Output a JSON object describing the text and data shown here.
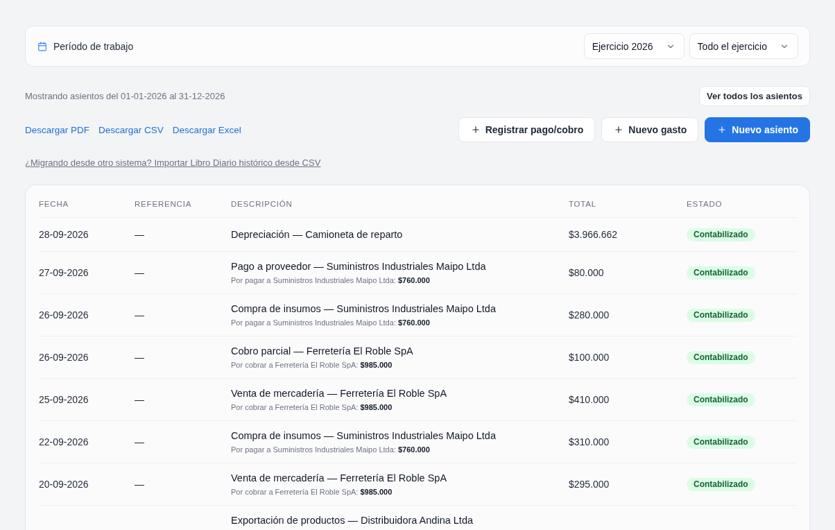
{
  "period": {
    "label": "Período de trabajo",
    "selects": [
      {
        "value": "Ejercicio 2026"
      },
      {
        "value": "Todo el ejercicio"
      }
    ]
  },
  "summary": "Mostrando asientos del 01-01-2026 al 31-12-2026",
  "view_all_button": "Ver todos los asientos",
  "download_links": [
    "Descargar PDF",
    "Descargar CSV",
    "Descargar Excel"
  ],
  "actions": [
    {
      "label": "Registrar pago/cobro",
      "kind": "secondary"
    },
    {
      "label": "Nuevo gasto",
      "kind": "secondary"
    },
    {
      "label": "Nuevo asiento",
      "kind": "primary"
    }
  ],
  "import_link": "¿Migrando desde otro sistema? Importar Libro Diario histórico desde CSV",
  "table": {
    "columns": [
      "FECHA",
      "REFERENCIA",
      "DESCRIPCIÓN",
      "TOTAL",
      "ESTADO"
    ],
    "rows": [
      {
        "date": "28-09-2026",
        "reference": "—",
        "description": "Depreciación — Camioneta de reparto",
        "total": "$3.966.662",
        "status": "Contabilizado"
      },
      {
        "date": "27-09-2026",
        "reference": "—",
        "description": "Pago a proveedor — Suministros Industriales Maipo Ltda",
        "note": "Por pagar a Suministros Industriales Maipo Ltda: **$760.000**",
        "total": "$80.000",
        "status": "Contabilizado"
      },
      {
        "date": "26-09-2026",
        "reference": "—",
        "description": "Compra de insumos — Suministros Industriales Maipo Ltda",
        "note": "Por pagar a Suministros Industriales Maipo Ltda: **$760.000**",
        "total": "$280.000",
        "status": "Contabilizado"
      },
      {
        "date": "26-09-2026",
        "reference": "—",
        "description": "Cobro parcial — Ferretería El Roble SpA",
        "note": "Por cobrar a Ferretería El Roble SpA: **$985.000**",
        "total": "$100.000",
        "status": "Contabilizado"
      },
      {
        "date": "25-09-2026",
        "reference": "—",
        "description": "Venta de mercadería — Ferretería El Roble SpA",
        "note": "Por cobrar a Ferretería El Roble SpA: **$985.000**",
        "total": "$410.000",
        "status": "Contabilizado"
      },
      {
        "date": "22-09-2026",
        "reference": "—",
        "description": "Compra de insumos — Suministros Industriales Maipo Ltda",
        "note": "Por pagar a Suministros Industriales Maipo Ltda: **$760.000**",
        "total": "$310.000",
        "status": "Contabilizado"
      },
      {
        "date": "20-09-2026",
        "reference": "—",
        "description": "Venta de mercadería — Ferretería El Roble SpA",
        "note": "Por cobrar a Ferretería El Roble SpA: **$985.000**",
        "total": "$295.000",
        "status": "Contabilizado"
      },
      {
        "description": "Exportación de productos — Distribuidora Andina Ltda"
      }
    ]
  }
}
